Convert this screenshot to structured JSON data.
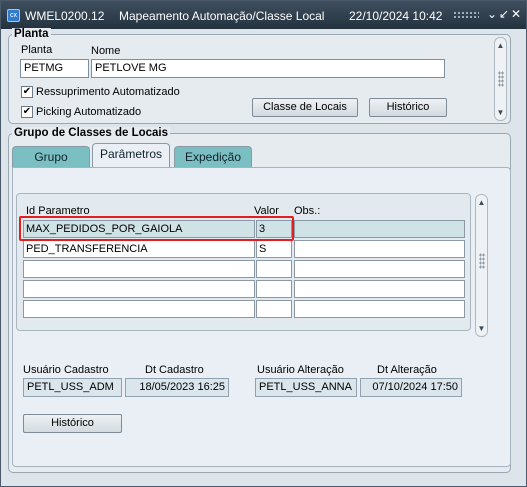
{
  "titlebar": {
    "app_icon": "cx",
    "app_code": "WMEL0200.12",
    "title": "Mapeamento Automação/Classe Local",
    "datetime": "22/10/2024 10:42",
    "minimize_glyph": "⌄",
    "maximize_glyph": "↙",
    "close_glyph": "✕"
  },
  "planta": {
    "section_title": "Planta",
    "planta_label": "Planta",
    "nome_label": "Nome",
    "planta_value": "PETMG",
    "nome_value": "PETLOVE MG",
    "ressuprimento_label": "Ressuprimento Automatizado",
    "ressuprimento_checked": true,
    "picking_label": "Picking Automatizado",
    "picking_checked": true,
    "check_glyph": "✔",
    "classe_locais_button": "Classe de Locais",
    "historico_button": "Histórico"
  },
  "grupo": {
    "section_title": "Grupo de Classes de Locais",
    "tabs": [
      {
        "label": "Grupo",
        "active": false
      },
      {
        "label": "Parâmetros",
        "active": true
      },
      {
        "label": "Expedição",
        "active": false
      }
    ],
    "table": {
      "columns": [
        "Id Parametro",
        "Valor",
        "Obs.:"
      ],
      "rows": [
        {
          "id": "MAX_PEDIDOS_POR_GAIOLA",
          "valor": "3",
          "obs": "",
          "selected": true
        },
        {
          "id": "PED_TRANSFERENCIA",
          "valor": "S",
          "obs": "",
          "selected": false
        },
        {
          "id": "",
          "valor": "",
          "obs": "",
          "selected": false
        },
        {
          "id": "",
          "valor": "",
          "obs": "",
          "selected": false
        },
        {
          "id": "",
          "valor": "",
          "obs": "",
          "selected": false
        }
      ]
    },
    "audit": {
      "usuario_cadastro_label": "Usuário  Cadastro",
      "dt_cadastro_label": "Dt Cadastro",
      "usuario_alteracao_label": "Usuário Alteração",
      "dt_alteracao_label": "Dt Alteração",
      "usuario_cadastro": "PETL_USS_ADM",
      "dt_cadastro": "18/05/2023 16:25",
      "usuario_alteracao": "PETL_USS_ANNA",
      "dt_alteracao": "07/10/2024 17:50"
    },
    "historico_button": "Histórico"
  },
  "colors": {
    "titlebar": "#2b3947",
    "tab_inactive": "#7cbfc3",
    "selected_row": "#cfe3e6",
    "highlight_border": "#e02020"
  }
}
